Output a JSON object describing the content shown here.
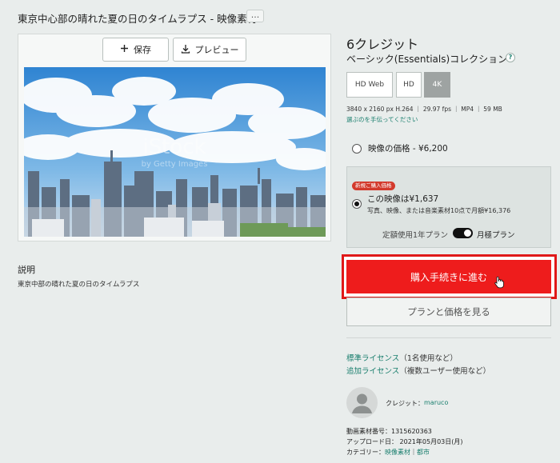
{
  "title": "東京中心部の晴れた夏の日のタイムラプス - 映像素材",
  "title_more": "...",
  "toolbar": {
    "save_label": "保存",
    "preview_label": "プレビュー"
  },
  "watermark": {
    "brand": "iStock",
    "sub": "by Getty Images"
  },
  "description": {
    "heading": "説明",
    "text": "東京中部の晴れた夏の日のタイムラプス"
  },
  "product": {
    "credits": "6クレジット",
    "collection": "ベーシック(Essentials)コレクション",
    "help_icon_text": "?"
  },
  "resolutions": {
    "items": [
      "HD Web",
      "HD",
      "4K"
    ],
    "selected": "4K"
  },
  "specs": "3840 x 2160 px H.264 ｜ 29.97 fps ｜ MP4 ｜ 59 MB",
  "help_link": "選ぶのを手伝ってください",
  "pricing": {
    "single_option": "映像の価格 - ¥6,200",
    "plan_badge": "新規ご購入価格",
    "plan_main": "この映像は¥1,637",
    "plan_sub": "写真、映像、または音楽素材10点で月額¥16,376",
    "toggle_left": "定額使用1年プラン",
    "toggle_right": "月極プラン"
  },
  "actions": {
    "checkout": "購入手続きに進む",
    "plans": "プランと価格を見る"
  },
  "licenses": {
    "standard_link": "標準ライセンス",
    "standard_desc": "（1名使用など）",
    "extended_link": "追加ライセンス",
    "extended_desc": "（複数ユーザー使用など）"
  },
  "contributor": {
    "label": "クレジット：",
    "name": "maruco"
  },
  "meta": {
    "id_line": "動画素材番号：1315620363",
    "date_line": "アップロード日：  2021年05月03日(月)",
    "category_label": "カテゴリー：",
    "category_1": "映像素材",
    "category_sep": "｜",
    "category_2": "都市"
  },
  "colors": {
    "accent": "#1a7f6e",
    "checkout": "#ee1c1c",
    "badge": "#d33a2c",
    "sky": "#3c8fd6"
  }
}
